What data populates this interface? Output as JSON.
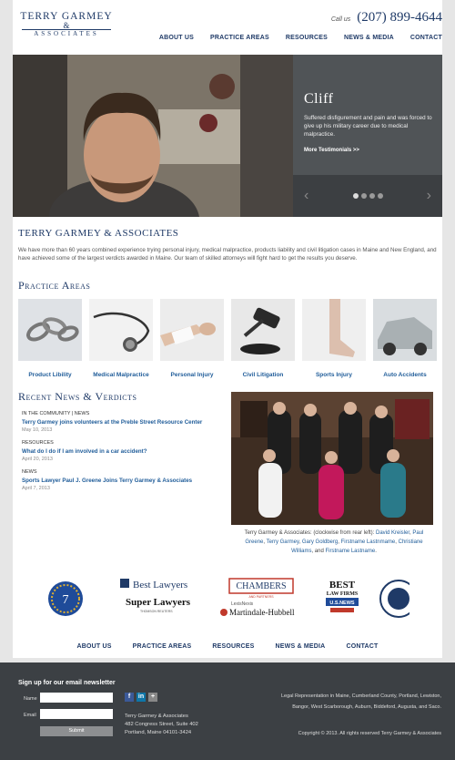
{
  "header": {
    "logo_line1": "Terry Garmey",
    "logo_amp": "&",
    "logo_line2": "Associates",
    "call_label": "Call us",
    "phone": "(207) 899-4644",
    "nav": [
      "ABOUT US",
      "PRACTICE AREAS",
      "RESOURCES",
      "NEWS & MEDIA",
      "CONTACT"
    ]
  },
  "hero": {
    "name": "Cliff",
    "quote": "Suffered disfigurement and pain and was forced to give up his military career due to medical malpractice.",
    "more": "More Testimonials >>",
    "prev": "‹",
    "next": "›"
  },
  "intro": {
    "title": "Terry Garmey & Associates",
    "text": "We have more than 60 years combined experience trying personal injury, medical malpractice, products liability and civil litigation cases in Maine and New England, and have achieved some of the largest verdicts awarded in Maine. Our team of skilled attorneys will fight hard to get the results you deserve."
  },
  "practice": {
    "title": "Practice Areas",
    "items": [
      "Product Libility",
      "Medical Malpractice",
      "Personal Injury",
      "Civil Litigation",
      "Sports Injury",
      "Auto Accidents"
    ]
  },
  "news": {
    "title": "Recent News & Verdicts",
    "items": [
      {
        "category": "IN THE COMMUNITY  |  NEWS",
        "title": "Terry Garmey joins volunteers at the Preble Street Resource Center",
        "date": "May 10, 2013"
      },
      {
        "category": "RESOURCES",
        "title": "What do I do if I am involved in a car accident?",
        "date": "April 20, 2013"
      },
      {
        "category": "NEWS",
        "title": "Sports Lawyer Paul J. Greene Joins Terry Garmey & Associates",
        "date": "April 7, 2013"
      }
    ]
  },
  "caption": {
    "prefix": "Terry Garmey & Associates: (clockwise from rear left): ",
    "names": [
      "David Kreisler",
      "Paul Greene",
      "Terry Garmey",
      "Gary Goldberg",
      "Firstname Lastnmame",
      "Christiane Williams"
    ],
    "and": ", and ",
    "last": "Firstname Lastname",
    "end": "."
  },
  "awards": {
    "badge_number": "7",
    "best_lawyers": "Best Lawyers",
    "super_lawyers": "Super Lawyers",
    "super_sub": "THOMSON REUTERS",
    "chambers": "CHAMBERS",
    "chambers_sub": "AND PARTNERS",
    "lexis": "LexisNexis",
    "martindale": "Martindale-Hubbell",
    "best_firms": "BEST",
    "best_firms2": "LAW FIRMS",
    "usnews": "U.S.NEWS"
  },
  "footer": {
    "nav": [
      "ABOUT US",
      "PRACTICE AREAS",
      "RESOURCES",
      "NEWS & MEDIA",
      "CONTACT"
    ],
    "newsletter_title": "Sign up for our email newsletter",
    "name_label": "Name",
    "email_label": "Email",
    "submit": "Submit",
    "firm": "Terry Garmey & Associates",
    "street": "482 Congress Street, Suite 402",
    "city": "Portland, Maine 04101-3424",
    "legal": "Legal Representation in Maine, Cumberland County, Portland, Lewiston, Bangor, West Scarborough, Auburn, Biddeford, Augusta, and Saco.",
    "copyright": "Copyright © 2013. All rights reserved Terry Garmey & Associates"
  },
  "colors": {
    "brand": "#1f3a67",
    "link": "#1f5c99",
    "footer_bg": "#3c4044"
  }
}
